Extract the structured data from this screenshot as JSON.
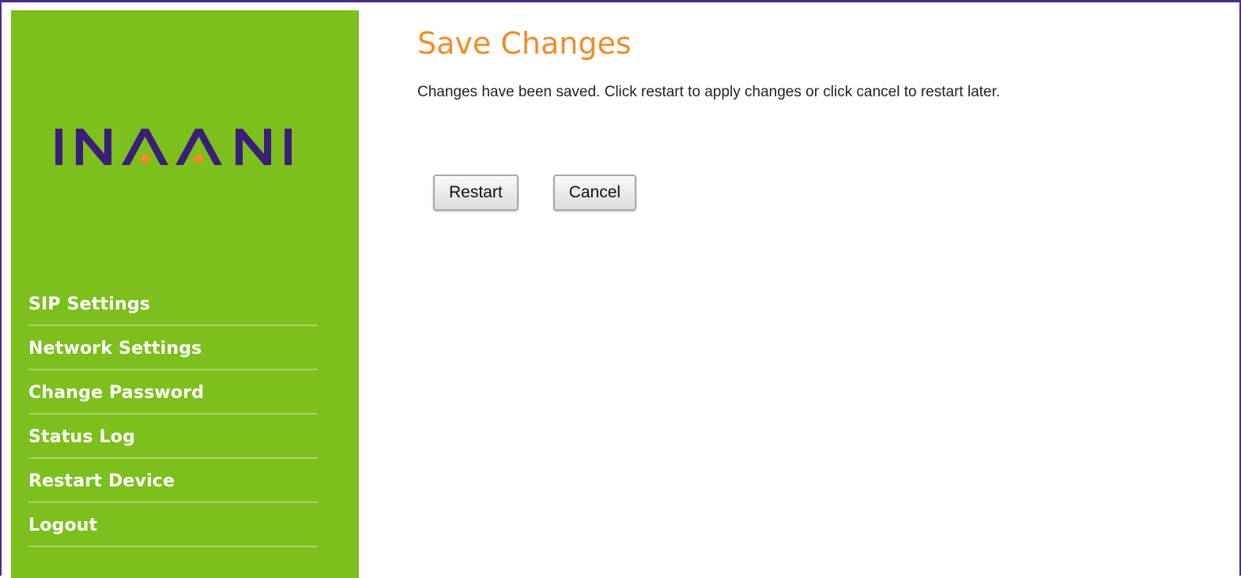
{
  "brand": {
    "logo_text": "INAANI",
    "colors": {
      "sidebar": "#7dbf1c",
      "logo_letters": "#3b1e78",
      "logo_dots": "#f08c2a",
      "title": "#f08c2a"
    }
  },
  "sidebar": {
    "items": [
      {
        "label": "SIP Settings"
      },
      {
        "label": "Network Settings"
      },
      {
        "label": "Change Password"
      },
      {
        "label": "Status Log"
      },
      {
        "label": "Restart Device"
      },
      {
        "label": "Logout"
      }
    ]
  },
  "main": {
    "title": "Save Changes",
    "message": "Changes have been saved. Click restart to apply changes or click cancel to restart later.",
    "restart_label": "Restart",
    "cancel_label": "Cancel"
  }
}
